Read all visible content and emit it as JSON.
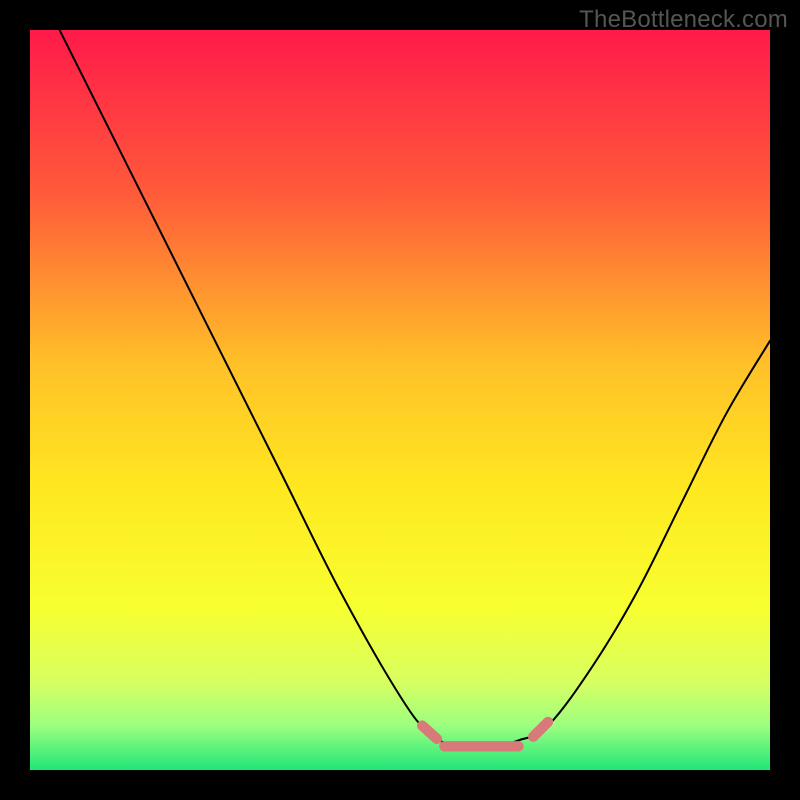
{
  "watermark": "TheBottleneck.com",
  "chart_data": {
    "type": "line",
    "title": "",
    "xlabel": "",
    "ylabel": "",
    "xlim": [
      0,
      100
    ],
    "ylim": [
      0,
      100
    ],
    "gradient_stops": [
      {
        "offset": 0,
        "color": "#ff1a4a"
      },
      {
        "offset": 22,
        "color": "#ff5a3a"
      },
      {
        "offset": 45,
        "color": "#ffc028"
      },
      {
        "offset": 62,
        "color": "#ffe820"
      },
      {
        "offset": 78,
        "color": "#f7ff30"
      },
      {
        "offset": 88,
        "color": "#d8ff60"
      },
      {
        "offset": 94,
        "color": "#9cff80"
      },
      {
        "offset": 100,
        "color": "#20e678"
      }
    ],
    "series": [
      {
        "name": "bottleneck-curve",
        "color": "#000000",
        "points": [
          {
            "x": 4,
            "y": 100
          },
          {
            "x": 10,
            "y": 88
          },
          {
            "x": 18,
            "y": 72
          },
          {
            "x": 26,
            "y": 56
          },
          {
            "x": 34,
            "y": 40
          },
          {
            "x": 42,
            "y": 24
          },
          {
            "x": 50,
            "y": 10
          },
          {
            "x": 54,
            "y": 5
          },
          {
            "x": 58,
            "y": 3
          },
          {
            "x": 62,
            "y": 3
          },
          {
            "x": 66,
            "y": 4
          },
          {
            "x": 70,
            "y": 6
          },
          {
            "x": 76,
            "y": 14
          },
          {
            "x": 82,
            "y": 24
          },
          {
            "x": 88,
            "y": 36
          },
          {
            "x": 94,
            "y": 48
          },
          {
            "x": 100,
            "y": 58
          }
        ]
      }
    ],
    "highlight": {
      "color": "#d97a7a",
      "stroke_width_percent": 1.4,
      "segments": [
        {
          "x1": 53,
          "y1": 6,
          "x2": 55,
          "y2": 4.2
        },
        {
          "x1": 56,
          "y1": 3.2,
          "x2": 66,
          "y2": 3.2
        },
        {
          "x1": 68,
          "y1": 4.5,
          "x2": 70,
          "y2": 6.5
        }
      ]
    }
  }
}
